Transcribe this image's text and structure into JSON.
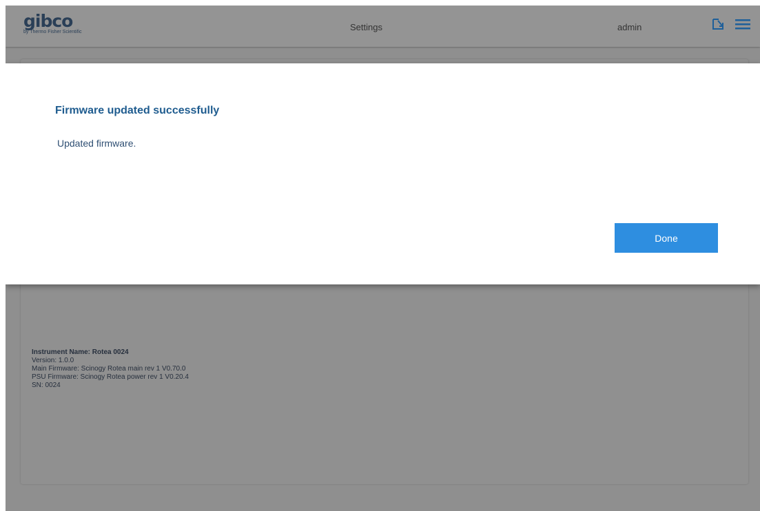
{
  "header": {
    "logo_text": "gibco",
    "logo_subtext": "by Thermo Fisher Scientific",
    "title": "Settings",
    "user": "admin",
    "icons": [
      "export-icon",
      "menu-icon"
    ]
  },
  "modal": {
    "title": "Firmware updated successfully",
    "message": "Updated firmware.",
    "done_label": "Done"
  },
  "instrument": {
    "name": "Instrument Name: Rotea 0024",
    "version": "Version: 1.0.0",
    "main_firmware": "Main Firmware: Scinogy Rotea main rev 1 V0.70.0",
    "psu_firmware": "PSU Firmware: Scinogy Rotea power rev 1 V0.20.4",
    "sn": "SN: 0024"
  },
  "colors": {
    "accent": "#2e8ee0",
    "title_blue": "#1f5c8f",
    "overlay_gray": "#8f8f8f"
  }
}
